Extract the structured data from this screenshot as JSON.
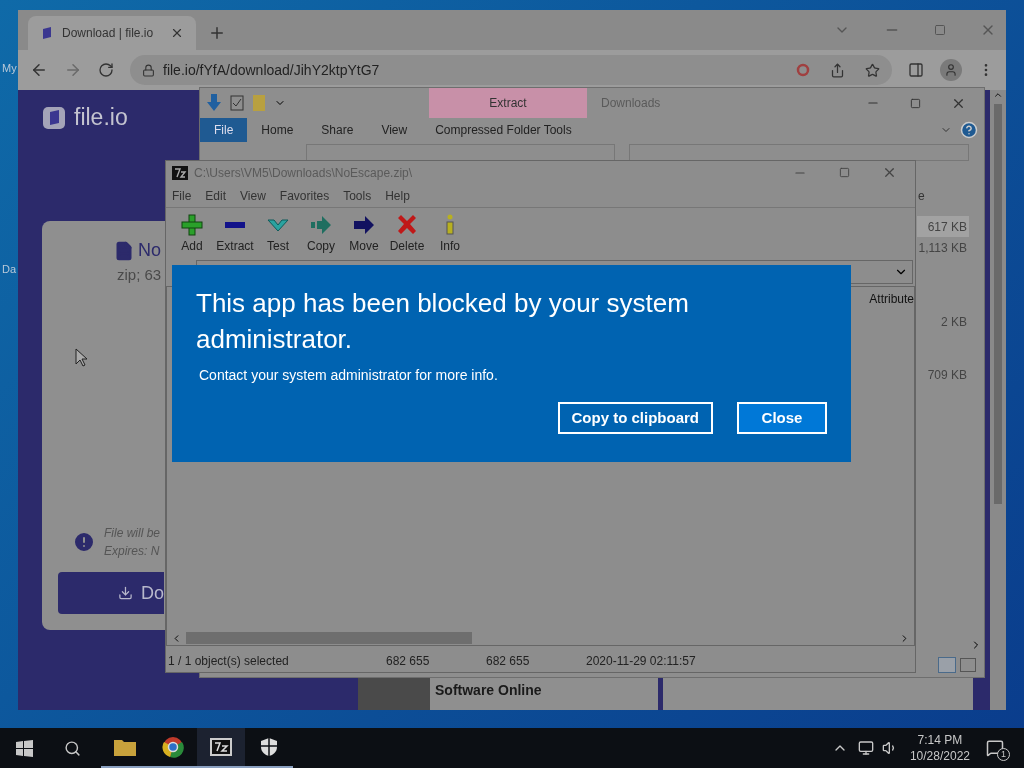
{
  "desktop": {
    "icon_labels": [
      "My",
      "Da"
    ]
  },
  "browser": {
    "tab_title": "Download | file.io",
    "url": "file.io/fYfA/download/JihY2ktpYtG7",
    "page": {
      "logo": "file.io",
      "file_name": "No",
      "file_meta": "zip; 63",
      "notice_lines": [
        "File will be",
        "Expires: N"
      ],
      "download_button": "Do",
      "ad_title": "Software Online"
    }
  },
  "explorer": {
    "title": "Downloads",
    "contextual_tab": "Extract",
    "ribbon_tabs": [
      {
        "label": "File",
        "selected": true
      },
      {
        "label": "Home",
        "selected": false
      },
      {
        "label": "Share",
        "selected": false
      },
      {
        "label": "View",
        "selected": false
      },
      {
        "label": "Compressed Folder Tools",
        "selected": false
      }
    ],
    "column_fragment": "e",
    "sizes": [
      {
        "size": "617 KB",
        "selected": true
      },
      {
        "size": "1,113 KB",
        "selected": false
      },
      {
        "size": "2 KB",
        "selected": false
      },
      {
        "size": "709 KB",
        "selected": false
      }
    ]
  },
  "archiver": {
    "title": "C:\\Users\\VM5\\Downloads\\NoEscape.zip\\",
    "menu": [
      "File",
      "Edit",
      "View",
      "Favorites",
      "Tools",
      "Help"
    ],
    "toolbar": [
      {
        "label": "Add",
        "kind": "add"
      },
      {
        "label": "Extract",
        "kind": "extract"
      },
      {
        "label": "Test",
        "kind": "test"
      },
      {
        "label": "Copy",
        "kind": "copy"
      },
      {
        "label": "Move",
        "kind": "move"
      },
      {
        "label": "Delete",
        "kind": "delete"
      },
      {
        "label": "Info",
        "kind": "info"
      }
    ],
    "column_header": "Attribute",
    "status": [
      "1 / 1 object(s) selected",
      "682 655",
      "682 655",
      "2020-11-29 02:11:57"
    ]
  },
  "dialog": {
    "title": "This app has been blocked by your system administrator.",
    "message": "Contact your system administrator for more info.",
    "buttons": [
      {
        "label": "Copy to clipboard",
        "kind": "secondary"
      },
      {
        "label": "Close",
        "kind": "primary"
      }
    ]
  },
  "taskbar": {
    "time": "7:14 PM",
    "date": "10/28/2022",
    "notification_count": "1"
  }
}
